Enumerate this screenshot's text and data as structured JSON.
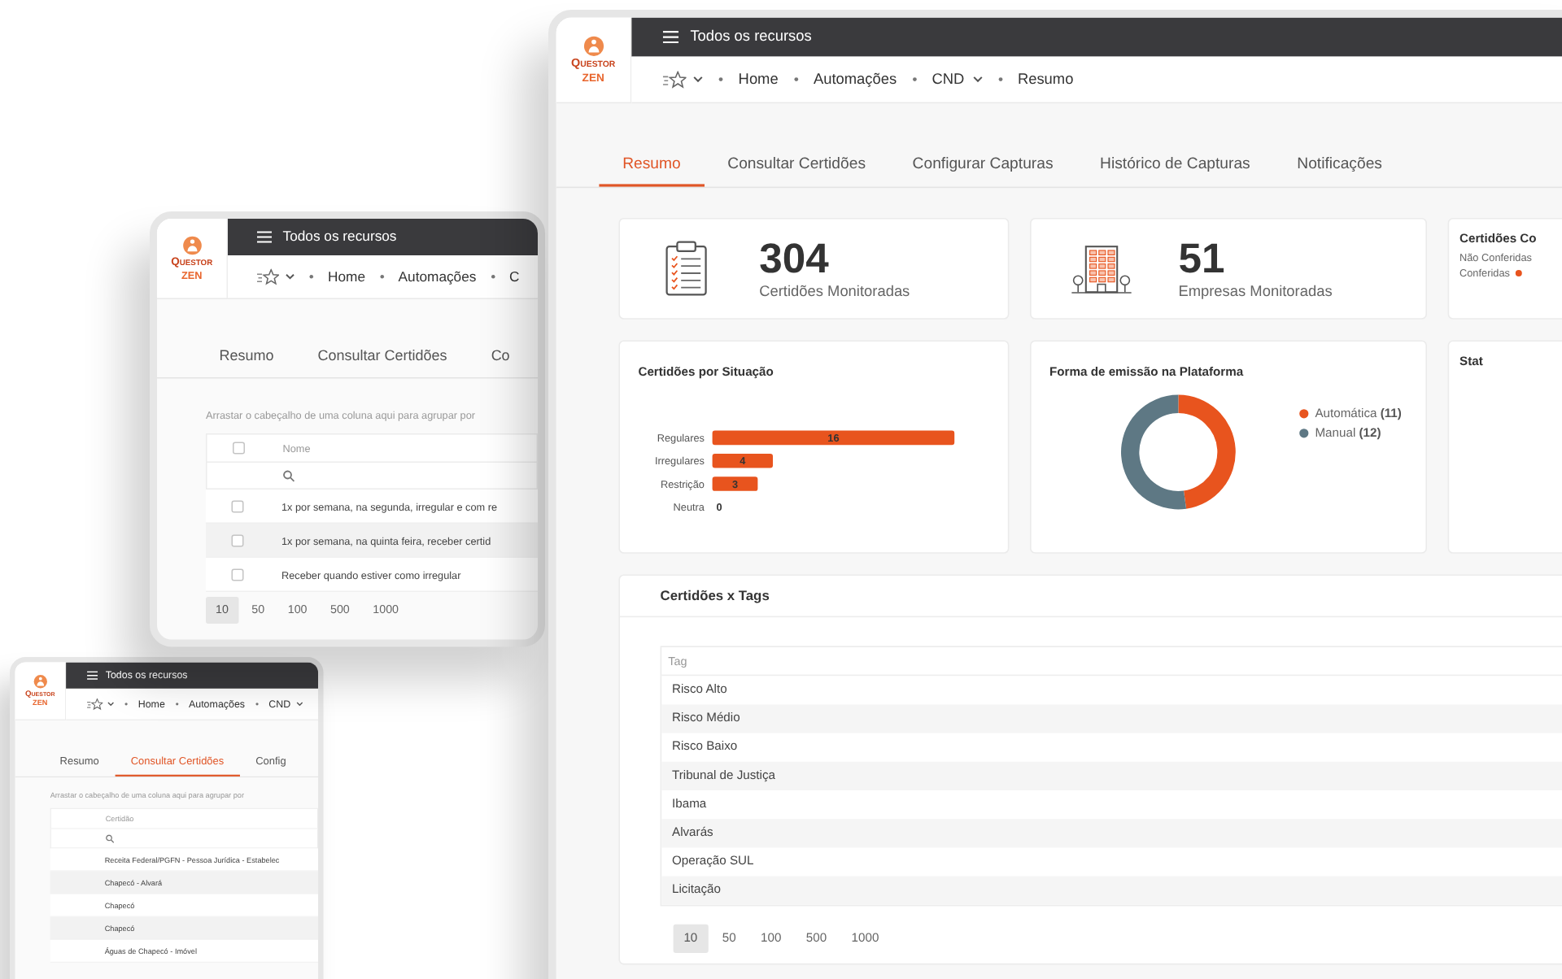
{
  "windows": [
    {
      "kind": "grid",
      "logo": {
        "brand": "QUESTOR",
        "product": "ZEN"
      },
      "header_title": "Todos os recursos",
      "breadcrumb": [
        {
          "label": "Home",
          "has_menu": false
        },
        {
          "label": "Automações",
          "has_menu": false
        },
        {
          "label": "CND",
          "has_menu": true
        }
      ],
      "tabs": [
        {
          "label": "Resumo",
          "selected": false
        },
        {
          "label": "Consultar Certidões",
          "selected": true
        },
        {
          "label": "Config",
          "selected": false
        }
      ],
      "group_hint": "Arrastar o cabeçalho de uma coluna aqui para agrupar por",
      "grid": {
        "column": "Certidão",
        "rows": [
          {
            "text": "Receita Federal/PGFN - Pessoa Jurídica - Estabelec"
          },
          {
            "text": "Chapecó - Alvará"
          },
          {
            "text": "Chapecó"
          },
          {
            "text": "Chapecó"
          },
          {
            "text": "Águas de Chapecó - Imóvel"
          }
        ]
      }
    },
    {
      "kind": "grid",
      "logo": {
        "brand": "QUESTOR",
        "product": "ZEN"
      },
      "header_title": "Todos os recursos",
      "breadcrumb": [
        {
          "label": "Home",
          "has_menu": false
        },
        {
          "label": "Automações",
          "has_menu": false
        },
        {
          "label": "C",
          "has_menu": false
        }
      ],
      "tabs": [
        {
          "label": "Resumo",
          "selected": false
        },
        {
          "label": "Consultar Certidões",
          "selected": false
        },
        {
          "label": "Co",
          "selected": false
        }
      ],
      "group_hint": "Arrastar o cabeçalho de uma coluna aqui para agrupar por",
      "grid": {
        "header_checked": false,
        "column": "Nome",
        "rows": [
          {
            "text": "1x por semana, na segunda, irregular e com re",
            "checked": false
          },
          {
            "text": "1x por semana, na quinta feira, receber certid",
            "checked": false
          },
          {
            "text": "Receber quando estiver como irregular",
            "checked": false
          }
        ]
      },
      "page_sizes": [
        {
          "label": "10",
          "selected": true
        },
        {
          "label": "50",
          "selected": false
        },
        {
          "label": "100",
          "selected": false
        },
        {
          "label": "500",
          "selected": false
        },
        {
          "label": "1000",
          "selected": false
        }
      ]
    },
    {
      "kind": "dashboard",
      "logo": {
        "brand": "QUESTOR",
        "product": "ZEN"
      },
      "header_title": "Todos os recursos",
      "breadcrumb": [
        {
          "label": "Home",
          "has_menu": false
        },
        {
          "label": "Automações",
          "has_menu": false
        },
        {
          "label": "CND",
          "has_menu": true
        },
        {
          "label": "Resumo",
          "has_menu": false
        }
      ],
      "tabs": [
        {
          "label": "Resumo",
          "selected": true
        },
        {
          "label": "Consultar Certidões",
          "selected": false
        },
        {
          "label": "Configurar Capturas",
          "selected": false
        },
        {
          "label": "Histórico de Capturas",
          "selected": false
        },
        {
          "label": "Notificações",
          "selected": false
        }
      ],
      "stats": [
        {
          "kind": "clipboard",
          "value": "304",
          "label": "Certidões Monitoradas"
        },
        {
          "kind": "building",
          "value": "51",
          "label": "Empresas Monitoradas"
        }
      ],
      "conference": {
        "title": "Certidões Co",
        "items": [
          {
            "label": "Não Conferidas"
          },
          {
            "label": "Conferidas",
            "color": "#e8541e"
          }
        ]
      },
      "situation": {
        "chart_data": {
          "type": "bar",
          "orientation": "horizontal",
          "title": "Certidões por Situação",
          "categories": [
            "Regulares",
            "Irregulares",
            "Restrição",
            "Neutra"
          ],
          "values": [
            16,
            4,
            3,
            0
          ],
          "data_labels": true
        }
      },
      "emission": {
        "chart_data": {
          "type": "donut",
          "title": "Forma de emissão na Plataforma",
          "values": [
            47.8,
            52.2
          ]
        },
        "legend": [
          {
            "label": "Automática **(11)**",
            "color": "#e8541e"
          },
          {
            "label": "Manual **(12)**",
            "color": "#5e7884"
          }
        ]
      },
      "status": {
        "title": "Stat"
      },
      "tags": {
        "title": "Certidões x Tags",
        "column": "Tag",
        "rows": [
          "Risco Alto",
          "Risco Médio",
          "Risco Baixo",
          "Tribunal de Justiça",
          "Ibama",
          "Alvarás",
          "Operação SUL",
          "Licitação"
        ],
        "page_sizes": [
          {
            "label": "10",
            "selected": true
          },
          {
            "label": "50",
            "selected": false
          },
          {
            "label": "100",
            "selected": false
          },
          {
            "label": "500",
            "selected": false
          },
          {
            "label": "1000",
            "selected": false
          }
        ]
      }
    }
  ]
}
